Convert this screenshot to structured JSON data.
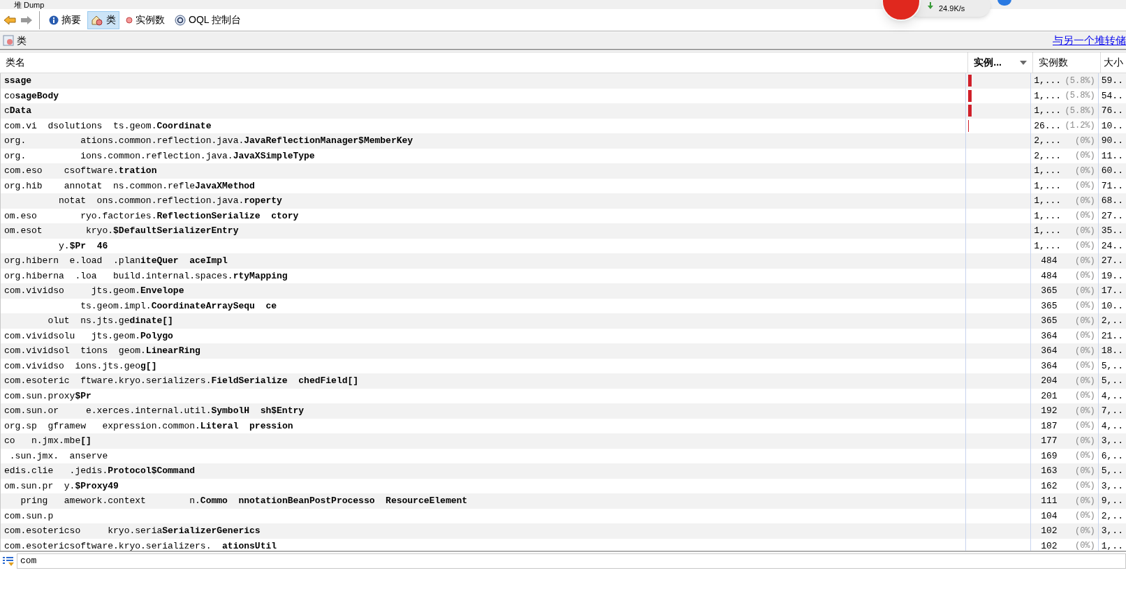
{
  "window": {
    "title": "堆 Dump"
  },
  "overlay": {
    "speed": "24.9K/s"
  },
  "toolbar": {
    "tabs": [
      {
        "label": "摘要",
        "selected": false
      },
      {
        "label": "类",
        "selected": true
      },
      {
        "label": "实例数",
        "selected": false
      },
      {
        "label": "OQL 控制台",
        "selected": false
      }
    ]
  },
  "panel": {
    "title": "类",
    "link": "与另一个堆转储"
  },
  "table": {
    "columns": [
      "类名",
      "实例...",
      "实例数",
      "大小"
    ],
    "rows": [
      {
        "pkg": "",
        "cls": "ssage",
        "level": 0.058,
        "count": "1,...",
        "percent": "(5.8%)",
        "size": "59.."
      },
      {
        "pkg": "co",
        "cls": "sageBody",
        "level": 0.058,
        "count": "1,...",
        "percent": "(5.8%)",
        "size": "54.."
      },
      {
        "pkg": "c",
        "cls": "Data",
        "level": 0.058,
        "count": "1,...",
        "percent": "(5.8%)",
        "size": "76.."
      },
      {
        "pkg": "com.vi  dsolutions  ts.geom.",
        "cls": "Coordinate",
        "level": 0.012,
        "count": "26...",
        "percent": "(1.2%)",
        "size": "10.."
      },
      {
        "pkg": "org.          ations.common.reflection.java.",
        "cls": "JavaReflectionManager$MemberKey",
        "count": "2,...",
        "percent": "(0%)",
        "size": "90.."
      },
      {
        "pkg": "org.          ions.common.reflection.java.",
        "cls": "JavaXSimpleType",
        "count": "2,...",
        "percent": "(0%)",
        "size": "11.."
      },
      {
        "pkg": "com.eso    csoftware.",
        "cls": "tration",
        "count": "1,...",
        "percent": "(0%)",
        "size": "60.."
      },
      {
        "pkg": "org.hib    annotat  ns.common.refle",
        "cls": "JavaXMethod",
        "count": "1,...",
        "percent": "(0%)",
        "size": "71.."
      },
      {
        "pkg": "          notat  ons.common.reflection.java.",
        "cls": "roperty",
        "count": "1,...",
        "percent": "(0%)",
        "size": "68.."
      },
      {
        "pkg": "om.eso        ryo.factories.",
        "cls": "ReflectionSerialize  ctory",
        "count": "1,...",
        "percent": "(0%)",
        "size": "27.."
      },
      {
        "pkg": "om.esot        kryo.",
        "cls": "$DefaultSerializerEntry",
        "count": "1,...",
        "percent": "(0%)",
        "size": "35.."
      },
      {
        "pkg": "          y.",
        "cls": "$Pr  46",
        "count": "1,...",
        "percent": "(0%)",
        "size": "24.."
      },
      {
        "pkg": "org.hibern  e.load  .plan",
        "cls": "iteQuer  aceImpl",
        "count": "484",
        "percent": "(0%)",
        "size": "27.."
      },
      {
        "pkg": "org.hiberna  .loa   build.internal.spaces.",
        "cls": "rtyMapping",
        "count": "484",
        "percent": "(0%)",
        "size": "19.."
      },
      {
        "pkg": "com.vividso     jts.geom.",
        "cls": "Envelope",
        "count": "365",
        "percent": "(0%)",
        "size": "17.."
      },
      {
        "pkg": "              ts.geom.impl.",
        "cls": "CoordinateArraySequ  ce",
        "count": "365",
        "percent": "(0%)",
        "size": "10.."
      },
      {
        "pkg": "        olut  ns.jts.ge",
        "cls": "dinate[]",
        "count": "365",
        "percent": "(0%)",
        "size": "2,.."
      },
      {
        "pkg": "com.vividsolu   jts.geom.",
        "cls": "Polygo",
        "count": "364",
        "percent": "(0%)",
        "size": "21.."
      },
      {
        "pkg": "com.vividsol  tions  geom.",
        "cls": "LinearRing",
        "count": "364",
        "percent": "(0%)",
        "size": "18.."
      },
      {
        "pkg": "com.vividso  ions.jts.geo",
        "cls": "g[]",
        "count": "364",
        "percent": "(0%)",
        "size": "5,.."
      },
      {
        "pkg": "com.esoteric  ftware.kryo.serializers.",
        "cls": "FieldSerialize  chedField[]",
        "count": "204",
        "percent": "(0%)",
        "size": "5,.."
      },
      {
        "pkg": "com.sun.proxy",
        "cls": "$Pr",
        "count": "201",
        "percent": "(0%)",
        "size": "4,.."
      },
      {
        "pkg": "com.sun.or     e.xerces.internal.util.",
        "cls": "SymbolH  sh$Entry",
        "count": "192",
        "percent": "(0%)",
        "size": "7,.."
      },
      {
        "pkg": "org.sp  gframew   expression.common.",
        "cls": "Literal  pression",
        "count": "187",
        "percent": "(0%)",
        "size": "4,.."
      },
      {
        "pkg": "co   n.jmx.mbe",
        "cls": "[]",
        "count": "177",
        "percent": "(0%)",
        "size": "3,.."
      },
      {
        "pkg": " .sun.jmx.  anserve",
        "count": "169",
        "percent": "(0%)",
        "size": "6,.."
      },
      {
        "pkg": "edis.clie   .jedis.",
        "cls": "Protocol$Command",
        "count": "163",
        "percent": "(0%)",
        "size": "5,.."
      },
      {
        "pkg": "om.sun.pr  y.",
        "cls": "$Proxy49",
        "count": "162",
        "percent": "(0%)",
        "size": "3,.."
      },
      {
        "pkg": "   pring   amework.context        n.",
        "cls": "Commo  nnotationBeanPostProcesso  ResourceElement",
        "count": "111",
        "percent": "(0%)",
        "size": "9,.."
      },
      {
        "pkg": "com.sun.p",
        "count": "104",
        "percent": "(0%)",
        "size": "2,.."
      },
      {
        "pkg": "com.esotericso     kryo.seria",
        "cls": "SerializerGenerics",
        "count": "102",
        "percent": "(0%)",
        "size": "3,.."
      },
      {
        "pkg": "com.esotericsoftware.kryo.serializers.",
        "cls": "  ationsUtil",
        "count": "102",
        "percent": "(0%)",
        "size": "1,.."
      }
    ]
  },
  "filter": {
    "value": "com"
  }
}
